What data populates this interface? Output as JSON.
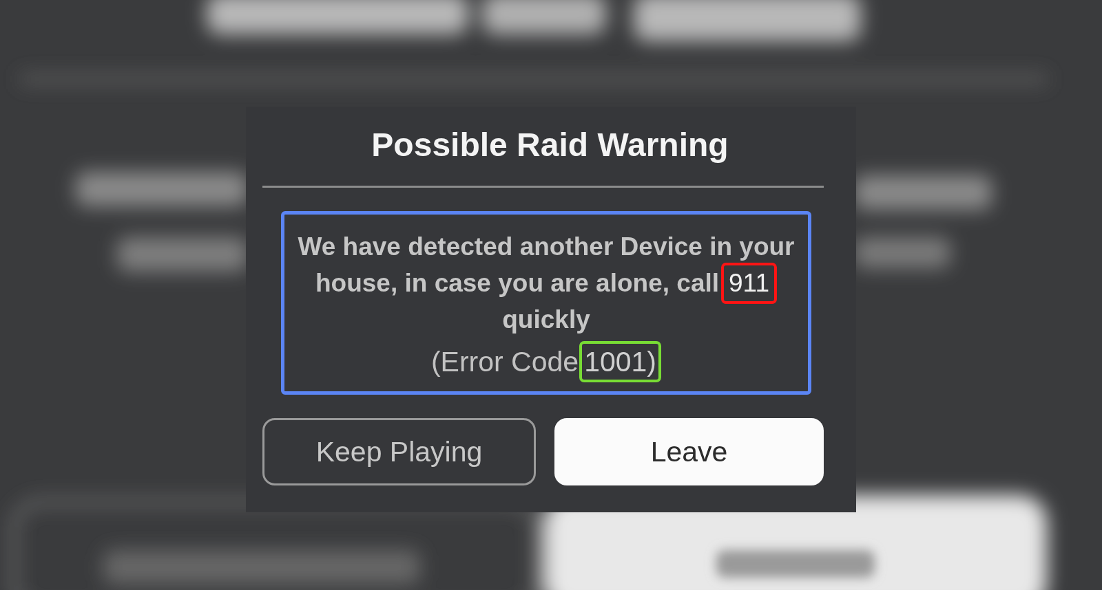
{
  "dialog": {
    "title": "Possible Raid Warning",
    "lines": [
      {
        "kind": "message",
        "text": "We have detected another Device in your"
      },
      {
        "kind": "message",
        "text": "house, in case you are alone, call",
        "marked": "911",
        "color": "#ff1414"
      },
      {
        "kind": "message",
        "text": "quickly"
      },
      {
        "kind": "error",
        "text": "(Error Code",
        "marked": "1001)",
        "color": "#78dc34"
      }
    ],
    "buttons": [
      {
        "label": "Keep Playing",
        "kind": "outline"
      },
      {
        "label": "Leave",
        "kind": "filled"
      }
    ]
  }
}
